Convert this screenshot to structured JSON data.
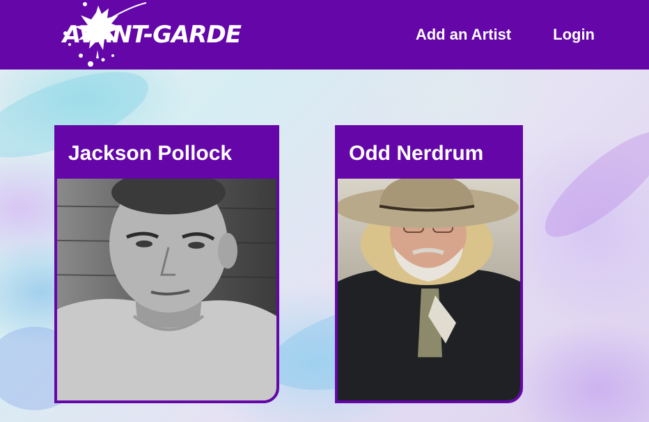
{
  "header": {
    "logo_text": "AVANT-GARDE",
    "nav": [
      {
        "label": "Add an Artist"
      },
      {
        "label": "Login"
      }
    ]
  },
  "artists": [
    {
      "name": "Jackson Pollock",
      "photo": "black-and-white portrait"
    },
    {
      "name": "Odd Nerdrum",
      "photo": "color portrait with hat"
    }
  ],
  "colors": {
    "brand_purple": "#6406a8",
    "text_white": "#ffffff"
  }
}
